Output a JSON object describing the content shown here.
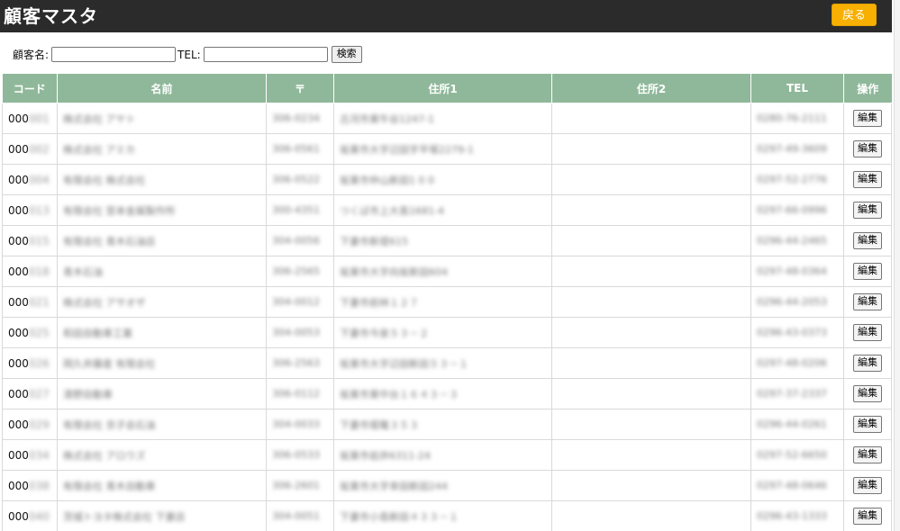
{
  "header": {
    "title": "顧客マスタ",
    "back_label": "戻る"
  },
  "search": {
    "name_label": "顧客名:",
    "name_value": "",
    "tel_label": "TEL:",
    "tel_value": "",
    "button_label": "検索"
  },
  "table": {
    "columns": [
      "コード",
      "名前",
      "〒",
      "住所1",
      "住所2",
      "TEL",
      "操作"
    ],
    "edit_label": "編集",
    "rows": [
      {
        "code_prefix": "000",
        "code_suffix": "001",
        "name": "株式会社 アヤト",
        "zip": "306-0234",
        "addr1": "古河市東牛谷1247-1",
        "addr2": "",
        "tel": "0280-76-2111"
      },
      {
        "code_prefix": "000",
        "code_suffix": "002",
        "name": "株式会社 アミカ",
        "zip": "306-0561",
        "addr1": "坂東市大字辺田字平塚2279-1",
        "addr2": "",
        "tel": "0297-49-3609"
      },
      {
        "code_prefix": "000",
        "code_suffix": "004",
        "name": "有限会社 株式会社",
        "zip": "306-0522",
        "addr1": "坂東市仲山新田1 0 0",
        "addr2": "",
        "tel": "0297-52-2776"
      },
      {
        "code_prefix": "000",
        "code_suffix": "013",
        "name": "有限会社 宮本金属製作所",
        "zip": "300-4351",
        "addr1": "つくば市上大島1681-4",
        "addr2": "",
        "tel": "0297-66-0996"
      },
      {
        "code_prefix": "000",
        "code_suffix": "015",
        "name": "有限会社 青木石油店",
        "zip": "304-0056",
        "addr1": "下妻市新堤615",
        "addr2": "",
        "tel": "0296-44-2465"
      },
      {
        "code_prefix": "000",
        "code_suffix": "018",
        "name": "青木石油",
        "zip": "306-2565",
        "addr1": "坂東市大字向坂新田604",
        "addr2": "",
        "tel": "0297-48-0364"
      },
      {
        "code_prefix": "000",
        "code_suffix": "021",
        "name": "株式会社 アサオザ",
        "zip": "304-0012",
        "addr1": "下妻市前林１２７",
        "addr2": "",
        "tel": "0296-44-2053"
      },
      {
        "code_prefix": "000",
        "code_suffix": "025",
        "name": "和田自動車工業",
        "zip": "304-0053",
        "addr1": "下妻市今泉５３－２",
        "addr2": "",
        "tel": "0296-43-0373"
      },
      {
        "code_prefix": "000",
        "code_suffix": "026",
        "name": "岡久井藤産 有限会社",
        "zip": "306-2563",
        "addr1": "坂東市大字辺田新田５３－１",
        "addr2": "",
        "tel": "0297-48-0206"
      },
      {
        "code_prefix": "000",
        "code_suffix": "027",
        "name": "清野自動車",
        "zip": "306-0112",
        "addr1": "坂東市東中台１６４３－３",
        "addr2": "",
        "tel": "0297-37-2337"
      },
      {
        "code_prefix": "000",
        "code_suffix": "029",
        "name": "有限会社 京子会石油",
        "zip": "304-0033",
        "addr1": "下妻市堀篭３５３",
        "addr2": "",
        "tel": "0296-44-0261"
      },
      {
        "code_prefix": "000",
        "code_suffix": "034",
        "name": "株式会社 アロウズ",
        "zip": "306-0533",
        "addr1": "坂東市岩井6311-24",
        "addr2": "",
        "tel": "0297-52-6650"
      },
      {
        "code_prefix": "000",
        "code_suffix": "038",
        "name": "有限会社 青木自動車",
        "zip": "306-2601",
        "addr1": "坂東市大字幸田新田244",
        "addr2": "",
        "tel": "0297-48-0646"
      },
      {
        "code_prefix": "000",
        "code_suffix": "040",
        "name": "茨城トヨタ株式会社 下妻店",
        "zip": "304-0051",
        "addr1": "下妻市小島新田４３３－１",
        "addr2": "",
        "tel": "0296-43-1333"
      }
    ]
  }
}
